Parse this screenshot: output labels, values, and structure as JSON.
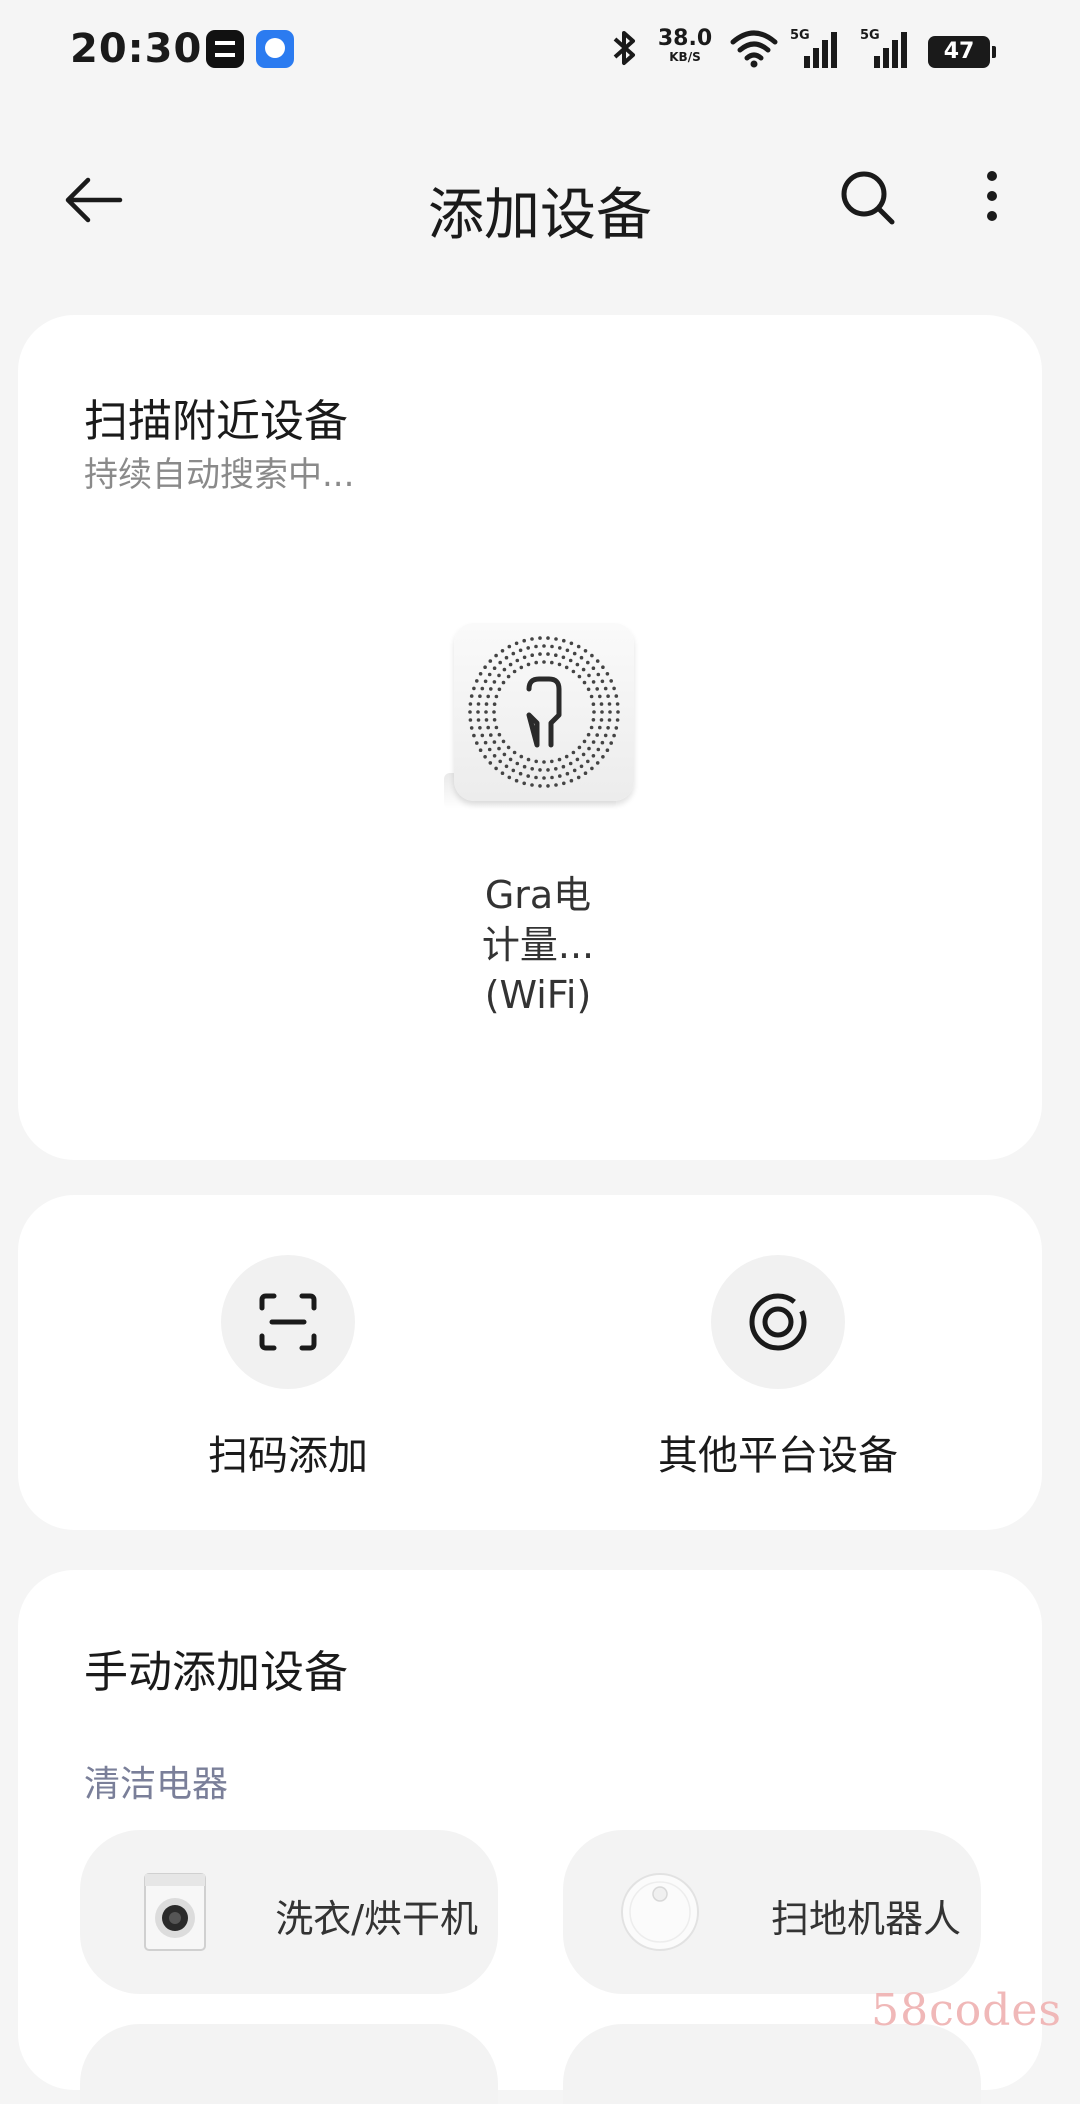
{
  "status_bar": {
    "time": "20:30",
    "net_speed_value": "38.0",
    "net_speed_unit": "KB/S",
    "signal1_label": "5G",
    "signal2_label": "5G",
    "battery": "47"
  },
  "nav": {
    "title": "添加设备"
  },
  "scan_card": {
    "title": "扫描附近设备",
    "subtitle": "持续自动搜索中...",
    "device": {
      "name_line1": "Gra电",
      "name_line2": "计量...",
      "name_line3": "(WiFi)"
    }
  },
  "quick_actions": [
    {
      "label": "扫码添加",
      "icon": "scan-code-icon"
    },
    {
      "label": "其他平台设备",
      "icon": "other-platform-icon"
    }
  ],
  "manual_card": {
    "title": "手动添加设备",
    "category": "清洁电器",
    "items": [
      {
        "label": "洗衣/烘干机",
        "icon": "washing-machine-icon"
      },
      {
        "label": "扫地机器人",
        "icon": "robot-vacuum-icon"
      }
    ]
  },
  "watermark": "58codes"
}
